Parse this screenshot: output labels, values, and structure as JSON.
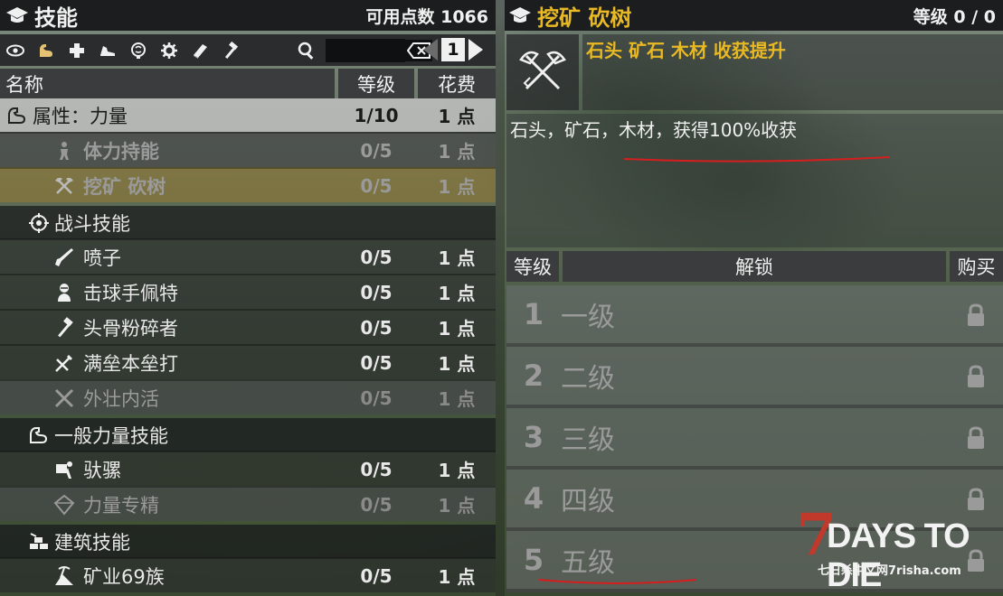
{
  "left": {
    "title": "技能",
    "points": "可用点数 1066",
    "search_value": "",
    "page_number": "1",
    "columns": {
      "name": "名称",
      "level": "等级",
      "cost": "花费"
    },
    "rows": [
      {
        "kind": "cat",
        "name": "属性：力量",
        "level": "1/10",
        "cost": "1 点",
        "icon": "bicep-icon"
      },
      {
        "kind": "skill",
        "name": "体力持能",
        "level": "0/5",
        "cost": "1 点",
        "icon": "figure-icon"
      },
      {
        "kind": "skill",
        "name": "挖矿 砍树",
        "level": "0/5",
        "cost": "1 点",
        "icon": "axe-pick-icon"
      },
      {
        "kind": "cat",
        "name": "战斗技能",
        "level": "",
        "cost": "",
        "icon": "crosshair-icon"
      },
      {
        "kind": "skill",
        "name": "喷子",
        "level": "0/5",
        "cost": "1 点",
        "icon": "shotgun-icon"
      },
      {
        "kind": "skill",
        "name": "击球手佩特",
        "level": "0/5",
        "cost": "1 点",
        "icon": "bat-icon"
      },
      {
        "kind": "skill",
        "name": "头骨粉碎者",
        "level": "0/5",
        "cost": "1 点",
        "icon": "sledgehammer-icon"
      },
      {
        "kind": "skill",
        "name": "满垒本垒打",
        "level": "0/5",
        "cost": "1 点",
        "icon": "swing-icon"
      },
      {
        "kind": "skill",
        "name": "外壮内活",
        "level": "0/5",
        "cost": "1 点",
        "icon": "crossed-bats-icon"
      },
      {
        "kind": "cat",
        "name": "一般力量技能",
        "level": "",
        "cost": "",
        "icon": "bicep-icon"
      },
      {
        "kind": "skill",
        "name": "驮骡",
        "level": "0/5",
        "cost": "1 点",
        "icon": "mule-icon"
      },
      {
        "kind": "skill",
        "name": "力量专精",
        "level": "0/5",
        "cost": "1 点",
        "icon": "gem-icon"
      },
      {
        "kind": "cat",
        "name": "建筑技能",
        "level": "",
        "cost": "",
        "icon": "bricks-icon"
      },
      {
        "kind": "skill",
        "name": "矿业69族",
        "level": "0/5",
        "cost": "1 点",
        "icon": "mining-icon"
      }
    ]
  },
  "right": {
    "title": "挖矿 砍树",
    "level": "等级 0 / 0",
    "short_desc": "石头 矿石 木材 收获提升",
    "long_desc": "石头，矿石，木材，获得100%收获",
    "columns": {
      "level": "等级",
      "unlock": "解锁",
      "buy": "购买"
    },
    "levels": [
      {
        "num": "1",
        "name": "一级"
      },
      {
        "num": "2",
        "name": "二级"
      },
      {
        "num": "3",
        "name": "三级"
      },
      {
        "num": "4",
        "name": "四级"
      },
      {
        "num": "5",
        "name": "五级"
      }
    ]
  },
  "logo": {
    "seven": "7",
    "text": "DAYS TO DIE",
    "sub": "七日杀中文网7risha.com"
  }
}
